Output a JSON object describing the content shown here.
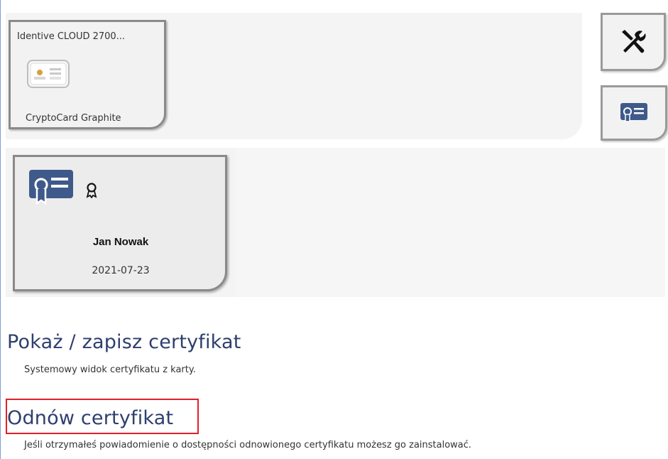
{
  "reader": {
    "name": "Identive CLOUD 2700...",
    "model": "CryptoCard Graphite",
    "icon": "smart-card-icon"
  },
  "toolbar": {
    "tools_icon": "tools-icon",
    "certificate_icon": "certificate-icon"
  },
  "certificate": {
    "owner": "Jan Nowak",
    "date": "2021-07-23",
    "icon": "certificate-icon",
    "badge_icon": "ribbon-icon"
  },
  "actions": {
    "show": {
      "title": "Pokaż / zapisz certyfikat",
      "description": "Systemowy widok certyfikatu z karty."
    },
    "renew": {
      "title": "Odnów certyfikat",
      "description": "Jeśli otrzymałeś powiadomienie o dostępności odnowionego certyfikatu możesz go zainstalować."
    }
  },
  "colors": {
    "accent": "#2e3f6e",
    "cert_icon": "#3f5a8a",
    "highlight": "#e0202a"
  }
}
